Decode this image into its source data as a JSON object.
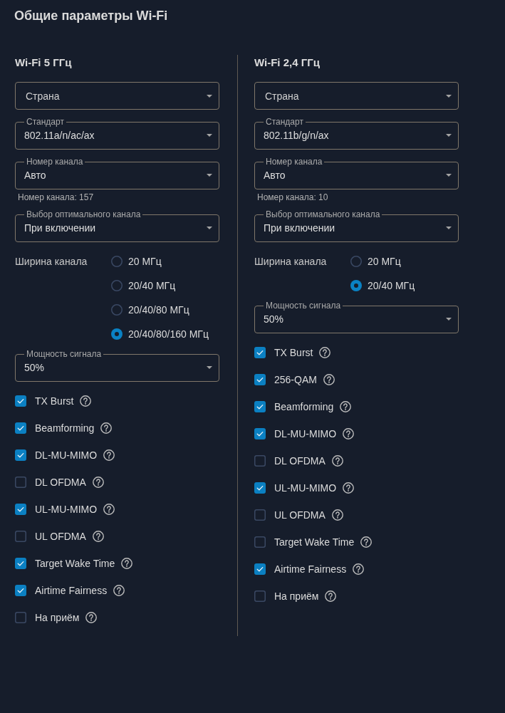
{
  "title": "Общие параметры Wi-Fi",
  "bands": [
    {
      "heading": "Wi-Fi 5 ГГц",
      "controls": [
        {
          "kind": "select",
          "placeholder": "Страна"
        },
        {
          "kind": "select",
          "label": "Стандарт",
          "value": "802.11a/n/ac/ax"
        },
        {
          "kind": "select",
          "label": "Номер канала",
          "value": "Авто",
          "helper": "Номер канала: 157"
        },
        {
          "kind": "select",
          "label": "Выбор оптимального канала",
          "value": "При включении"
        },
        {
          "kind": "radio_group",
          "label": "Ширина канала",
          "options": [
            {
              "label": "20 МГц",
              "selected": false
            },
            {
              "label": "20/40 МГц",
              "selected": false
            },
            {
              "label": "20/40/80 МГц",
              "selected": false
            },
            {
              "label": "20/40/80/160 МГц",
              "selected": true
            }
          ]
        },
        {
          "kind": "select",
          "label": "Мощность сигнала",
          "value": "50%"
        }
      ],
      "features": [
        {
          "label": "TX Burst",
          "checked": true
        },
        {
          "label": "Beamforming",
          "checked": true
        },
        {
          "label": "DL-MU-MIMO",
          "checked": true
        },
        {
          "label": "DL OFDMA",
          "checked": false
        },
        {
          "label": "UL-MU-MIMO",
          "checked": true
        },
        {
          "label": "UL OFDMA",
          "checked": false
        },
        {
          "label": "Target Wake Time",
          "checked": true
        },
        {
          "label": "Airtime Fairness",
          "checked": true
        },
        {
          "label": "На приём",
          "checked": false
        }
      ]
    },
    {
      "heading": "Wi-Fi 2,4 ГГц",
      "controls": [
        {
          "kind": "select",
          "placeholder": "Страна"
        },
        {
          "kind": "select",
          "label": "Стандарт",
          "value": "802.11b/g/n/ax"
        },
        {
          "kind": "select",
          "label": "Номер канала",
          "value": "Авто",
          "helper": "Номер канала: 10"
        },
        {
          "kind": "select",
          "label": "Выбор оптимального канала",
          "value": "При включении"
        },
        {
          "kind": "radio_group",
          "label": "Ширина канала",
          "options": [
            {
              "label": "20 МГц",
              "selected": false
            },
            {
              "label": "20/40 МГц",
              "selected": true
            }
          ]
        },
        {
          "kind": "select",
          "label": "Мощность сигнала",
          "value": "50%"
        }
      ],
      "features": [
        {
          "label": "TX Burst",
          "checked": true
        },
        {
          "label": "256-QAM",
          "checked": true
        },
        {
          "label": "Beamforming",
          "checked": true
        },
        {
          "label": "DL-MU-MIMO",
          "checked": true
        },
        {
          "label": "DL OFDMA",
          "checked": false
        },
        {
          "label": "UL-MU-MIMO",
          "checked": true
        },
        {
          "label": "UL OFDMA",
          "checked": false
        },
        {
          "label": "Target Wake Time",
          "checked": false
        },
        {
          "label": "Airtime Fairness",
          "checked": true
        },
        {
          "label": "На приём",
          "checked": false
        }
      ]
    }
  ]
}
